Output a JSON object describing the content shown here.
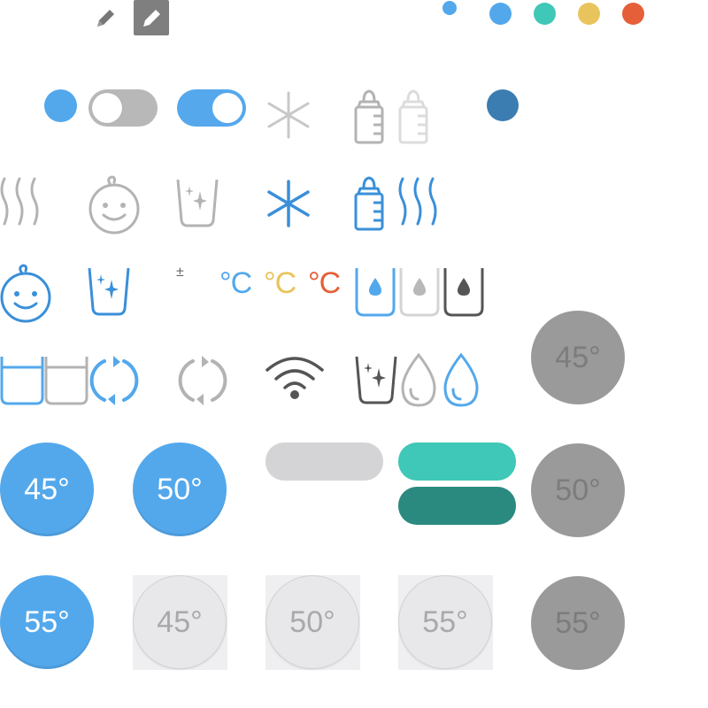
{
  "buttons": {
    "active": [
      "45°",
      "50°",
      "55°"
    ],
    "light": [
      "45°",
      "50°",
      "55°"
    ],
    "dark": [
      "45°",
      "50°",
      "55°"
    ]
  },
  "temp_unit": {
    "blue": "°C",
    "yellow": "°C",
    "orange": "°C",
    "plus_minus": "±"
  },
  "colors": {
    "blue": "#53a8ec",
    "dark_blue": "#3b7db1",
    "teal": "#3fc7b7",
    "dark_teal": "#2b8a80",
    "yellow": "#e9c45c",
    "orange": "#e55f38",
    "gray": "#b3b3b3",
    "light_gray": "#d4d4d6",
    "dark_gray": "#555555"
  },
  "icons": [
    "pencil-icon",
    "pencil-box-icon",
    "snowflake-icon",
    "bottle-icon",
    "steam-icon",
    "baby-face-icon",
    "cup-sparkle-icon",
    "water-drop-icon",
    "cup-drop-icon",
    "cup-water-icon",
    "refresh-icon",
    "wifi-icon"
  ]
}
